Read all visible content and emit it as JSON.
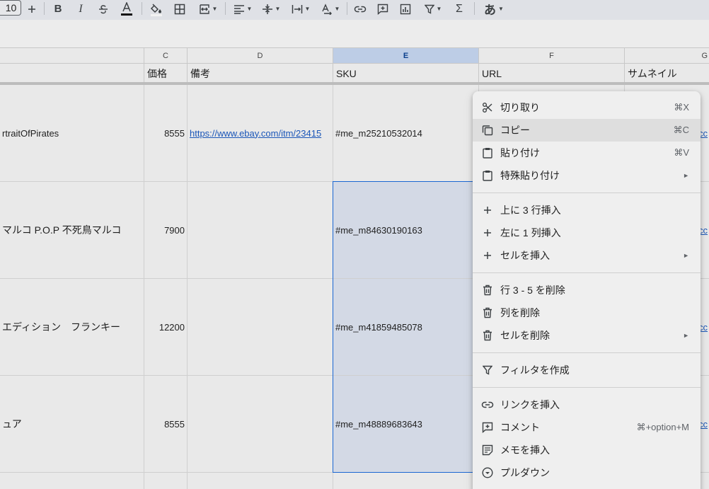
{
  "toolbar": {
    "font_size": "10",
    "ime_label": "あ"
  },
  "columns": {
    "c": "C",
    "d": "D",
    "e": "E",
    "f": "F",
    "g": "G"
  },
  "header_row": {
    "price": "価格",
    "notes": "備考",
    "sku": "SKU",
    "url": "URL",
    "thumbnail": "サムネイル"
  },
  "rows": [
    {
      "name": "rtraitOfPirates",
      "price": "8555",
      "notes": "https://www.ebay.com/itm/23415",
      "sku": "#me_m25210532014",
      "g": "cc"
    },
    {
      "name": "マルコ P.O.P 不死鳥マルコ",
      "price": "7900",
      "notes": "",
      "sku": "#me_m84630190163",
      "g": "cc"
    },
    {
      "name": "エディション　フランキー",
      "price": "12200",
      "notes": "",
      "sku": "#me_m41859485078",
      "g": "cc"
    },
    {
      "name": "ュア",
      "price": "8555",
      "notes": "",
      "sku": "#me_m48889683643",
      "g": "cc"
    }
  ],
  "context_menu": {
    "cut": {
      "label": "切り取り",
      "shortcut": "⌘X"
    },
    "copy": {
      "label": "コピー",
      "shortcut": "⌘C"
    },
    "paste": {
      "label": "貼り付け",
      "shortcut": "⌘V"
    },
    "paste_special": {
      "label": "特殊貼り付け"
    },
    "insert_rows_above": {
      "label": "上に 3 行挿入"
    },
    "insert_col_left": {
      "label": "左に 1 列挿入"
    },
    "insert_cells": {
      "label": "セルを挿入"
    },
    "delete_rows": {
      "label": "行 3 - 5 を削除"
    },
    "delete_column": {
      "label": "列を削除"
    },
    "delete_cells": {
      "label": "セルを削除"
    },
    "create_filter": {
      "label": "フィルタを作成"
    },
    "insert_link": {
      "label": "リンクを挿入"
    },
    "comment": {
      "label": "コメント",
      "shortcut": "⌘+option+M"
    },
    "insert_note": {
      "label": "メモを挿入"
    },
    "dropdown": {
      "label": "プルダウン"
    }
  },
  "colors": {
    "selection_fill": "#d3d9e5",
    "selection_border": "#1a66d2",
    "link": "#1a56b8",
    "selected_col_header": "#bdcde6"
  }
}
